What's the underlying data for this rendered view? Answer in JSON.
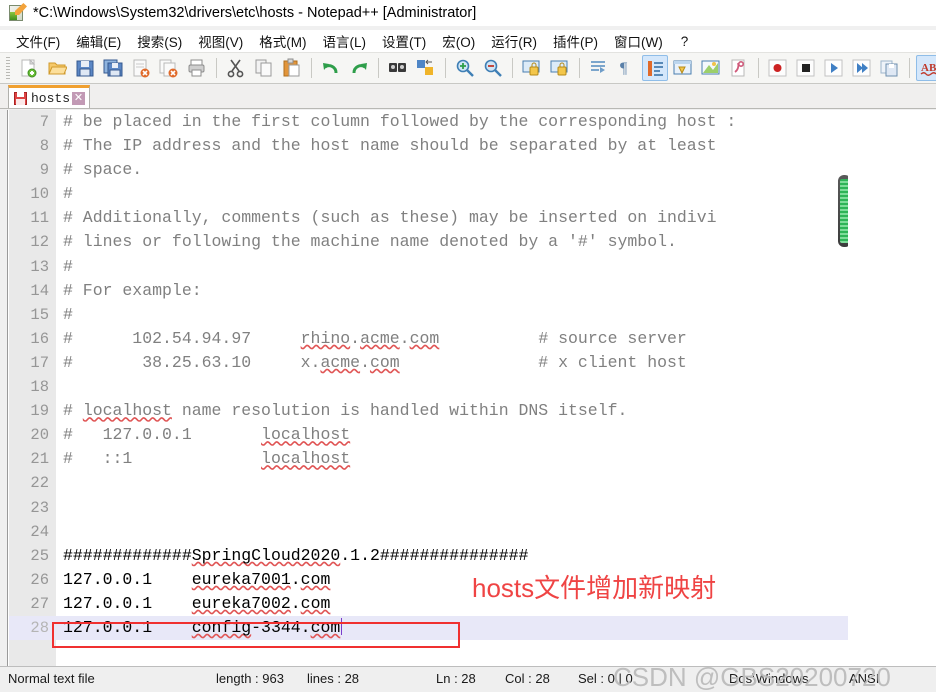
{
  "window": {
    "title": "*C:\\Windows\\System32\\drivers\\etc\\hosts - Notepad++ [Administrator]",
    "icon": "notepad-plus-plus-icon"
  },
  "menu": {
    "items": [
      {
        "label": "文件(F)"
      },
      {
        "label": "编辑(E)"
      },
      {
        "label": "搜索(S)"
      },
      {
        "label": "视图(V)"
      },
      {
        "label": "格式(M)"
      },
      {
        "label": "语言(L)"
      },
      {
        "label": "设置(T)"
      },
      {
        "label": "宏(O)"
      },
      {
        "label": "运行(R)"
      },
      {
        "label": "插件(P)"
      },
      {
        "label": "窗口(W)"
      },
      {
        "label": "?"
      }
    ]
  },
  "toolbar": {
    "buttons": [
      "new-file-icon",
      "open-file-icon",
      "save-icon",
      "save-all-icon",
      "close-file-icon",
      "close-all-icon",
      "print-icon",
      "sep",
      "cut-icon",
      "copy-icon",
      "paste-icon",
      "sep",
      "undo-icon",
      "redo-icon",
      "sep",
      "find-icon",
      "replace-icon",
      "sep",
      "zoom-in-icon",
      "zoom-out-icon",
      "sep",
      "sync-vertical-scroll-icon",
      "sync-horizontal-scroll-icon",
      "sep",
      "word-wrap-icon",
      "show-all-characters-icon",
      "indent-guide-icon",
      "user-defined-language-icon",
      "document-map-icon",
      "function-list-icon",
      "sep",
      "record-macro-icon",
      "stop-macro-icon",
      "play-macro-icon",
      "run-macro-multiple-icon",
      "save-macro-icon",
      "sep",
      "spell-check-icon",
      "run-icon"
    ],
    "selected": [
      "indent-guide-icon",
      "spell-check-icon"
    ]
  },
  "tab": {
    "label": "hosts",
    "close_label": "✕",
    "modified_icon": "unsaved-save-icon"
  },
  "editor": {
    "first_visible_line": 7,
    "current_line": 28,
    "lines": [
      {
        "n": 7,
        "text": "# be placed in the first column followed by the corresponding host :",
        "comment": true
      },
      {
        "n": 8,
        "text": "# The IP address and the host name should be separated by at least ",
        "comment": true
      },
      {
        "n": 9,
        "text": "# space.",
        "comment": true
      },
      {
        "n": 10,
        "text": "#",
        "comment": true
      },
      {
        "n": 11,
        "text": "# Additionally, comments (such as these) may be inserted on indivi",
        "comment": true
      },
      {
        "n": 12,
        "text": "# lines or following the machine name denoted by a '#' symbol.",
        "comment": true
      },
      {
        "n": 13,
        "text": "#",
        "comment": true
      },
      {
        "n": 14,
        "text": "# For example:",
        "comment": true
      },
      {
        "n": 15,
        "text": "#",
        "comment": true
      },
      {
        "n": 16,
        "text": "#      102.54.94.97     rhino.acme.com          # source server",
        "comment": true
      },
      {
        "n": 17,
        "text": "#       38.25.63.10     x.acme.com              # x client host",
        "comment": true
      },
      {
        "n": 18,
        "text": "",
        "comment": true
      },
      {
        "n": 19,
        "text": "# localhost name resolution is handled within DNS itself.",
        "comment": true
      },
      {
        "n": 20,
        "text": "#   127.0.0.1       localhost",
        "comment": true
      },
      {
        "n": 21,
        "text": "#   ::1             localhost",
        "comment": true
      },
      {
        "n": 22,
        "text": "",
        "comment": true
      },
      {
        "n": 23,
        "text": "",
        "comment": true
      },
      {
        "n": 24,
        "text": "",
        "comment": true
      },
      {
        "n": 25,
        "text": "#############SpringCloud2020.1.2###############",
        "comment": false
      },
      {
        "n": 26,
        "text": "127.0.0.1    eureka7001.com",
        "comment": false
      },
      {
        "n": 27,
        "text": "127.0.0.1    eureka7002.com",
        "comment": false
      },
      {
        "n": 28,
        "text": "127.0.0.1    config-3344.com",
        "comment": false
      }
    ]
  },
  "annotations": {
    "red_note": "hosts文件增加新映射",
    "red_note_color": "#ef4444",
    "highlight_rect_color": "#f03030"
  },
  "scrollbar": {
    "thumb_color": "#2fb457"
  },
  "statusbar": {
    "file_type": "Normal text file",
    "length_label": "length : 963",
    "lines_label": "lines : 28",
    "ln": "Ln : 28",
    "col": "Col : 28",
    "sel": "Sel : 0 | 0",
    "eol": "Dos\\Windows",
    "encoding": "ANSI"
  },
  "watermark": {
    "text": "CSDN @GBS20200720"
  }
}
